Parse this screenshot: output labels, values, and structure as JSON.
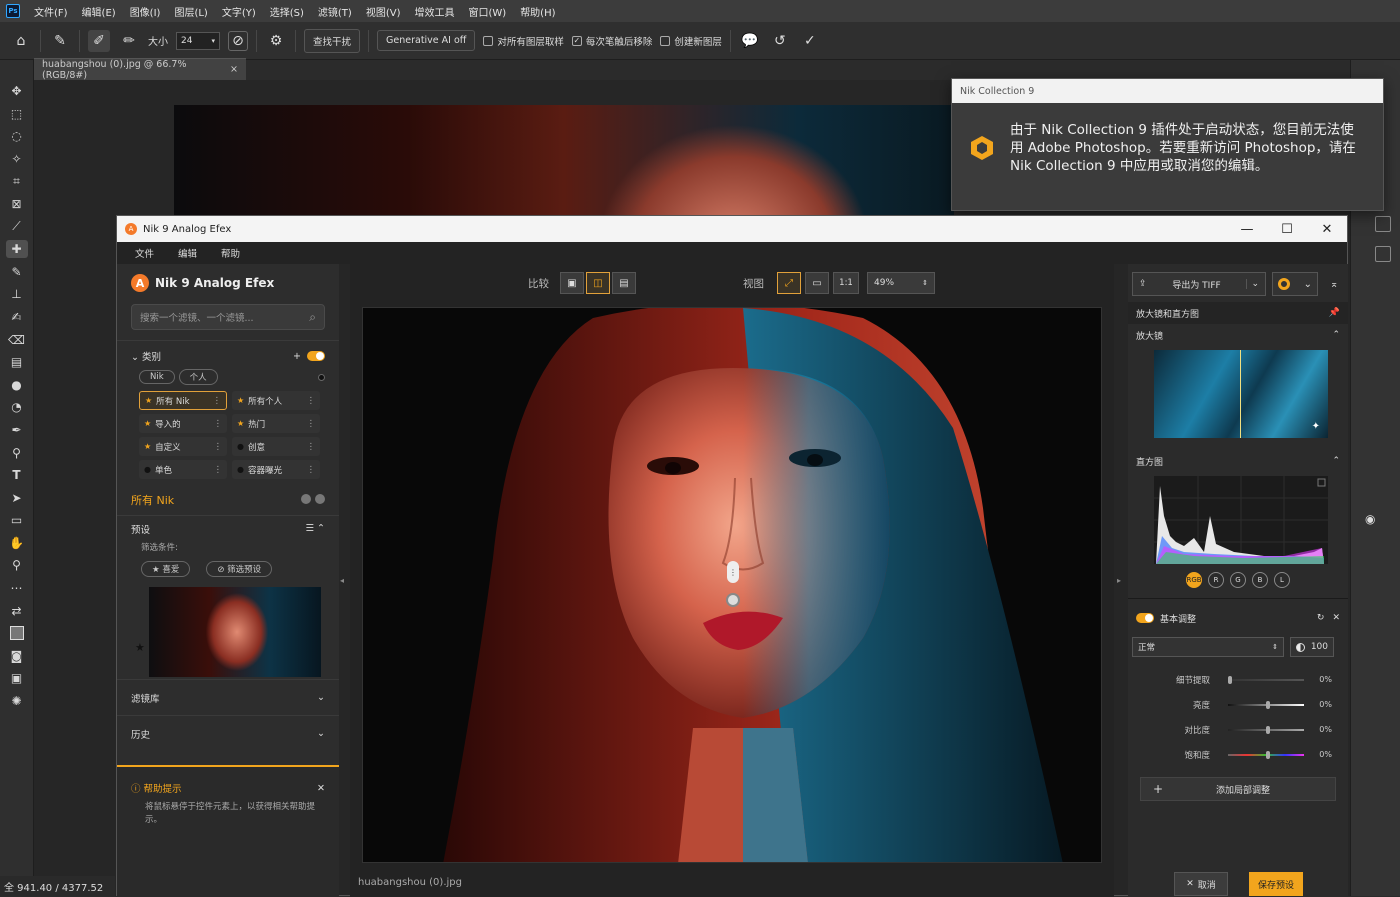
{
  "ps": {
    "menu": [
      "文件(F)",
      "编辑(E)",
      "图像(I)",
      "图层(L)",
      "文字(Y)",
      "选择(S)",
      "滤镜(T)",
      "视图(V)",
      "增效工具",
      "窗口(W)",
      "帮助(H)"
    ],
    "options": {
      "size_label": "大小",
      "size_value": "24",
      "remove_button": "查找干扰",
      "generative_ai": "Generative AI off",
      "check1": "对所有图层取样",
      "check2": "每次笔触后移除",
      "check3": "创建新图层"
    },
    "doc_tab": "huabangshou (0).jpg @ 66.7%(RGB/8#)",
    "status": "全 941.40 / 4377.52"
  },
  "notification": {
    "title": "Nik Collection 9",
    "message": "由于 Nik Collection 9 插件处于启动状态，您目前无法使用 Adobe Photoshop。若要重新访问 Photoshop，请在 Nik Collection 9 中应用或取消您的编辑。"
  },
  "nik": {
    "window_title": "Nik 9 Analog Efex",
    "menu": [
      "文件",
      "编辑",
      "帮助"
    ],
    "brand": "Nik 9 Analog Efex",
    "search_placeholder": "搜索一个滤镜、一个滤镜...",
    "categories_title": "类别",
    "filters": [
      "Nik",
      "个人"
    ],
    "categories": [
      {
        "label": "所有 Nik",
        "icon": "star",
        "selected": true
      },
      {
        "label": "所有个人",
        "icon": "star",
        "selected": false
      },
      {
        "label": "导入的",
        "icon": "star",
        "selected": false
      },
      {
        "label": "热门",
        "icon": "star",
        "selected": false
      },
      {
        "label": "自定义",
        "icon": "star",
        "selected": false
      },
      {
        "label": "创意",
        "icon": "dot",
        "selected": false
      },
      {
        "label": "单色",
        "icon": "dot",
        "selected": false
      },
      {
        "label": "容器曝光",
        "icon": "dot",
        "selected": false
      }
    ],
    "all_nik": "所有 Nik",
    "presets_title": "预设",
    "filter_options": "筛选条件:",
    "favorites_button": "喜爱",
    "filter_button": "筛选预设",
    "library": "滤镜库",
    "history": "历史",
    "tip_title": "帮助提示",
    "tip_text": "将鼠标悬停于控件元素上，以获得相关帮助提示。",
    "compare_label": "比较",
    "view_label": "视图",
    "zoom_one": "1:1",
    "zoom_value": "49%",
    "image_name": "huabangshou (0).jpg",
    "export_button": "导出为 TIFF",
    "loupe_title": "放大镜和直方图",
    "loupe_label": "放大镜",
    "histogram_label": "直方图",
    "hist_buttons": [
      "RGB",
      "R",
      "G",
      "B",
      "L"
    ],
    "basic_title": "基本调整",
    "blend_mode": "正常",
    "opacity": "100",
    "sliders": [
      {
        "label": "细节提取",
        "value": "0%",
        "pos": 0
      },
      {
        "label": "亮度",
        "value": "0%",
        "pos": 50
      },
      {
        "label": "对比度",
        "value": "0%",
        "pos": 50
      },
      {
        "label": "饱和度",
        "value": "0%",
        "pos": 50
      }
    ],
    "add_adjust": "添加局部调整",
    "cancel_button": "取消",
    "apply_button": "保存预设"
  },
  "colors": {
    "accent": "#f2a51d",
    "panel": "#2d2d2d",
    "canvas_bg": "#232323"
  }
}
